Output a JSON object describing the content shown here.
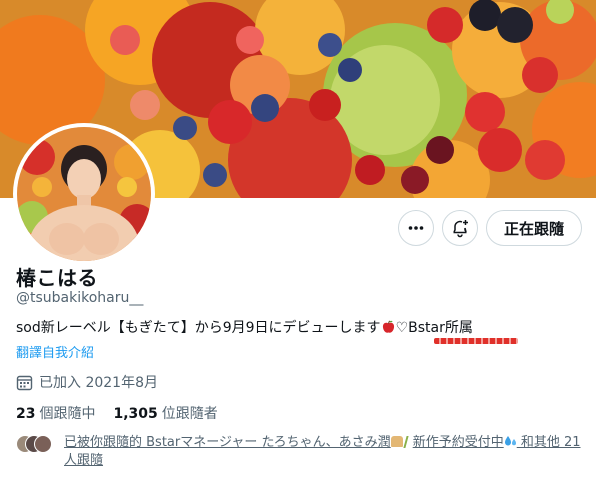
{
  "profile": {
    "display_name": "椿こはる",
    "handle": "@tsubakikoharu__",
    "bio_part1": "sod新レーベル【もぎたて】から9月9日にデビューします",
    "bio_part2": "♡Bstar所属",
    "translate_link": "翻譯自我介紹",
    "joined": "已加入 2021年8月",
    "following_count": "23",
    "following_label": "個跟隨中",
    "followers_count": "1,305",
    "followers_label": "位跟隨者"
  },
  "actions": {
    "follow_label": "正在跟隨"
  },
  "followed_by": {
    "text_part1": "已被你跟隨的 Bstarマネージャー たろちゃん、あさみ潤",
    "text_part2": "新作予約受付中",
    "text_part3": " 和其他 21 人跟隨"
  },
  "icons": {
    "more": "more-icon",
    "notify": "bell-plus-icon",
    "calendar": "calendar-icon",
    "apple": "red-apple-emoji",
    "bread": "bread-emoji",
    "sprig": "herb-emoji",
    "drops": "sweat-droplets-emoji"
  },
  "colors": {
    "link": "#1d9bf0",
    "secondary_text": "#536471",
    "border": "#cfd9de"
  }
}
